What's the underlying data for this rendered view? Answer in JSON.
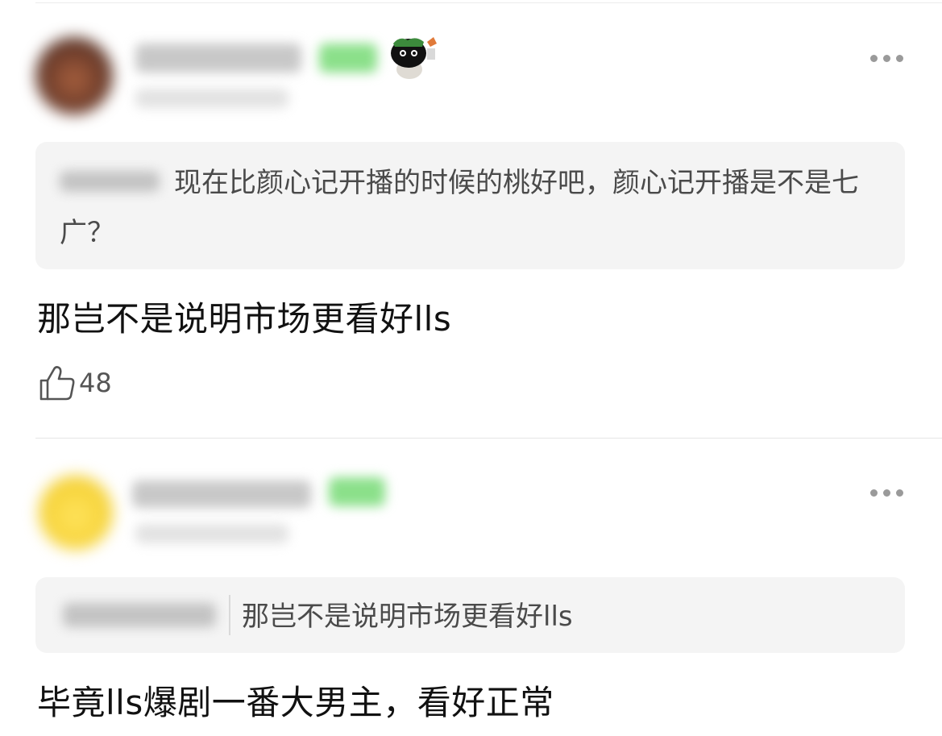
{
  "comments": [
    {
      "quote_text": "现在比颜心记开播的时候的桃好吧，颜心记开播是不是七广？",
      "body": "那岂不是说明市场更看好lls",
      "like_count": "48"
    },
    {
      "quote_text": "那岂不是说明市场更看好lls",
      "body": "毕竟lls爆剧一番大男主，看好正常"
    }
  ],
  "icons": {
    "more": "more-options-icon",
    "like": "thumbs-up-icon"
  },
  "colors": {
    "background": "#ffffff",
    "quote_bg": "#f4f4f4",
    "badge_green": "#8be08a",
    "text": "#111111",
    "quote_text": "#4a4a4a"
  }
}
